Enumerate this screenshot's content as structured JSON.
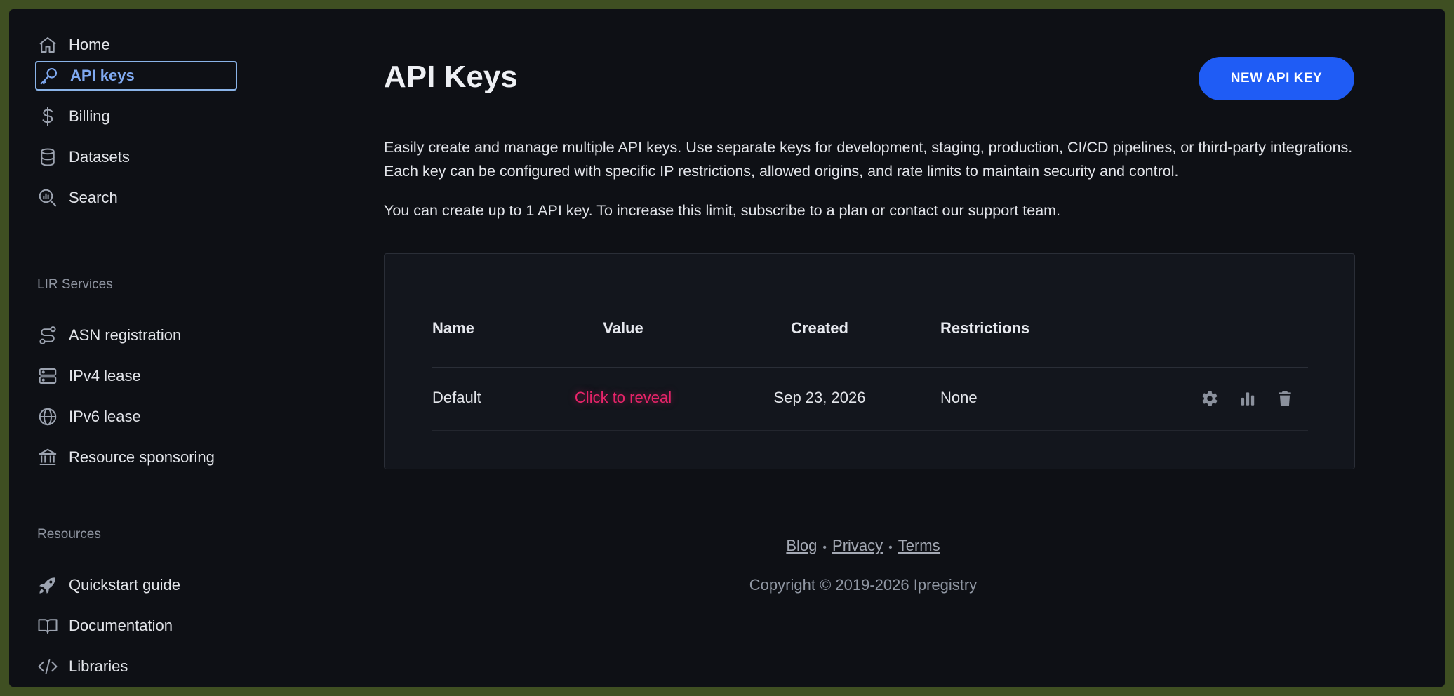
{
  "sidebar": {
    "items": [
      {
        "label": "Home",
        "icon": "home-icon"
      },
      {
        "label": "API keys",
        "icon": "key-icon",
        "active": true
      },
      {
        "label": "Billing",
        "icon": "dollar-icon"
      },
      {
        "label": "Datasets",
        "icon": "database-icon"
      },
      {
        "label": "Search",
        "icon": "search-chart-icon"
      }
    ],
    "lir_label": "LIR Services",
    "lir_items": [
      {
        "label": "ASN registration",
        "icon": "route-icon"
      },
      {
        "label": "IPv4 lease",
        "icon": "server-icon"
      },
      {
        "label": "IPv6 lease",
        "icon": "globe-icon"
      },
      {
        "label": "Resource sponsoring",
        "icon": "bank-icon"
      }
    ],
    "resources_label": "Resources",
    "resource_items": [
      {
        "label": "Quickstart guide",
        "icon": "rocket-icon"
      },
      {
        "label": "Documentation",
        "icon": "book-icon"
      },
      {
        "label": "Libraries",
        "icon": "code-icon"
      }
    ]
  },
  "main": {
    "title": "API Keys",
    "new_button": "NEW API KEY",
    "description": "Easily create and manage multiple API keys. Use separate keys for development, staging, production, CI/CD pipelines, or third-party integrations. Each key can be configured with specific IP restrictions, allowed origins, and rate limits to maintain security and control.",
    "limit_text": "You can create up to 1 API key. To increase this limit, subscribe to a plan or contact our support team.",
    "table": {
      "headers": [
        "Name",
        "Value",
        "Created",
        "Restrictions"
      ],
      "rows": [
        {
          "name": "Default",
          "value": "Click to reveal",
          "created": "Sep 23, 2026",
          "restrictions": "None"
        }
      ]
    }
  },
  "footer": {
    "links": [
      "Blog",
      "Privacy",
      "Terms"
    ],
    "separator": "•",
    "copyright": "Copyright © 2019-2026 Ipregistry"
  },
  "colors": {
    "accent": "#1f5cf5",
    "active_nav": "#7fa9f0",
    "reveal": "#e8246a",
    "background": "#0e1015"
  }
}
